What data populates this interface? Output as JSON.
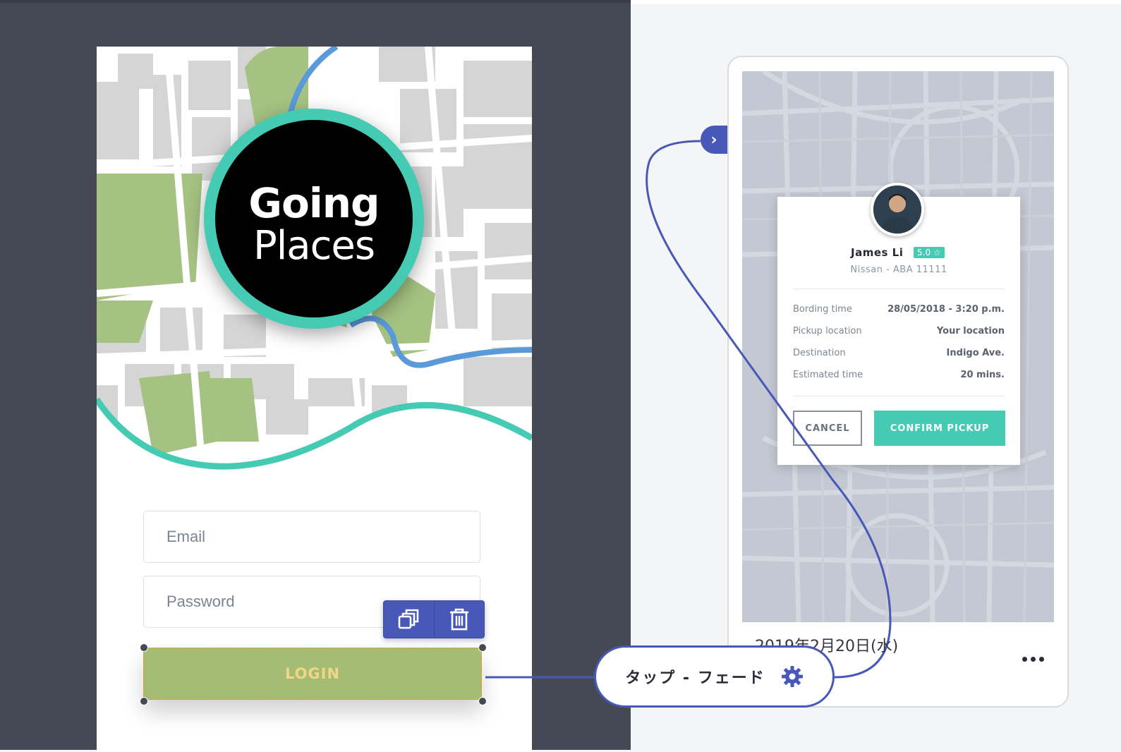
{
  "left_screen": {
    "logo": {
      "line1": "Going",
      "line2": "Places"
    },
    "email_placeholder": "Email",
    "password_placeholder": "Password",
    "login_label": "LOGIN",
    "toolbar": {
      "duplicate_icon": "duplicate-icon",
      "delete_icon": "trash-icon"
    }
  },
  "transition": {
    "label": "タップ - フェード",
    "settings_icon": "gear-icon"
  },
  "right_screen": {
    "driver": {
      "name": "James Li",
      "rating": "5.0 ☆",
      "vehicle": "Nissan - ABA 11111"
    },
    "details": [
      {
        "label": "Bording time",
        "value": "28/05/2018 - 3:20 p.m."
      },
      {
        "label": "Pickup location",
        "value": "Your location"
      },
      {
        "label": "Destination",
        "value": "Indigo Ave."
      },
      {
        "label": "Estimated time",
        "value": "20 mins."
      }
    ],
    "cancel_label": "CANCEL",
    "confirm_label": "CONFIRM PICKUP",
    "date": "2019年2月20日(水)"
  },
  "colors": {
    "accent": "#45cbb4",
    "link": "#4858b8",
    "login": "#a5bc73",
    "canvas": "#454955"
  }
}
